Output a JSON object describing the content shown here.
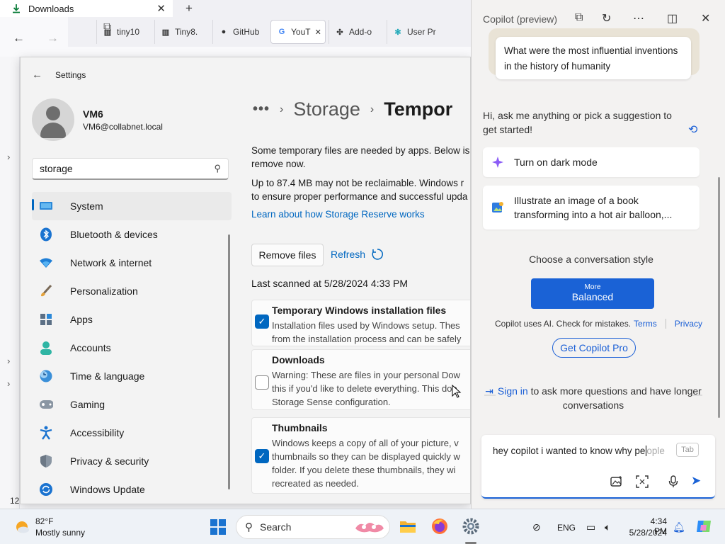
{
  "firefox": {
    "active_tab": "Downloads",
    "tabs": [
      "tiny10",
      "Tiny8.",
      "GitHub",
      "YouT",
      "Add-o",
      "User Pr"
    ],
    "status_text": "12"
  },
  "settings": {
    "title": "Settings",
    "user": {
      "name": "VM6",
      "email": "VM6@collabnet.local"
    },
    "search_value": "storage",
    "nav": [
      {
        "label": "System",
        "icon": "system-icon"
      },
      {
        "label": "Bluetooth & devices",
        "icon": "bluetooth-icon"
      },
      {
        "label": "Network & internet",
        "icon": "wifi-icon"
      },
      {
        "label": "Personalization",
        "icon": "brush-icon"
      },
      {
        "label": "Apps",
        "icon": "apps-icon"
      },
      {
        "label": "Accounts",
        "icon": "account-icon"
      },
      {
        "label": "Time & language",
        "icon": "clock-globe-icon"
      },
      {
        "label": "Gaming",
        "icon": "gamepad-icon"
      },
      {
        "label": "Accessibility",
        "icon": "accessibility-icon"
      },
      {
        "label": "Privacy & security",
        "icon": "shield-icon"
      },
      {
        "label": "Windows Update",
        "icon": "update-icon"
      }
    ],
    "breadcrumb": {
      "dots": "•••",
      "storage": "Storage",
      "current": "Tempor"
    },
    "intro_1": "Some temporary files are needed by apps. Below is",
    "intro_2": "remove now.",
    "reclaim_1": "Up to 87.4 MB may not be reclaimable. Windows r",
    "reclaim_2": "to ensure proper performance and successful upda",
    "learn_link": "Learn about how Storage Reserve works",
    "remove_button": "Remove files",
    "refresh_button": "Refresh",
    "last_scanned": "Last scanned at 5/28/2024 4:33 PM",
    "items": [
      {
        "title": "Temporary Windows installation files",
        "checked": true,
        "desc": [
          "Installation files used by Windows setup.  Thes",
          "from the installation process and can be safely"
        ]
      },
      {
        "title": "Downloads",
        "checked": false,
        "desc": [
          "Warning: These are files in your personal Dow",
          "this if you'd like to delete everything. This doe",
          "Storage Sense configuration."
        ]
      },
      {
        "title": "Thumbnails",
        "checked": true,
        "desc": [
          "Windows keeps a copy of all of your picture, v",
          "thumbnails so they can be displayed quickly w",
          "folder. If you delete these thumbnails, they wi",
          "recreated as needed."
        ]
      }
    ]
  },
  "copilot": {
    "title": "Copilot (preview)",
    "suggestion_card": "What were the most influential inventions in the history of humanity",
    "greeting": "Hi, ask me anything or pick a suggestion to get started!",
    "chips": [
      {
        "label": "Turn on dark mode",
        "icon": "sparkle-icon"
      },
      {
        "label": "Illustrate an image of a book transforming into a hot air balloon,...",
        "icon": "image-create-icon"
      }
    ],
    "style_label": "Choose a conversation style",
    "style_top": "More",
    "style_main": "Balanced",
    "disclaimer": "Copilot uses AI. Check for mistakes.",
    "terms": "Terms",
    "privacy": "Privacy",
    "pro_button": "Get Copilot Pro",
    "signin_link": "Sign in",
    "signin_rest": "to ask more questions and have longer conversations",
    "input_text": "hey copilot i wanted to know why pe",
    "input_ghost": "ople",
    "tab_hint": "Tab"
  },
  "taskbar": {
    "temp": "82°F",
    "weather": "Mostly sunny",
    "search": "Search",
    "lang": "ENG",
    "time": "4:34 PM",
    "date": "5/28/2024"
  }
}
